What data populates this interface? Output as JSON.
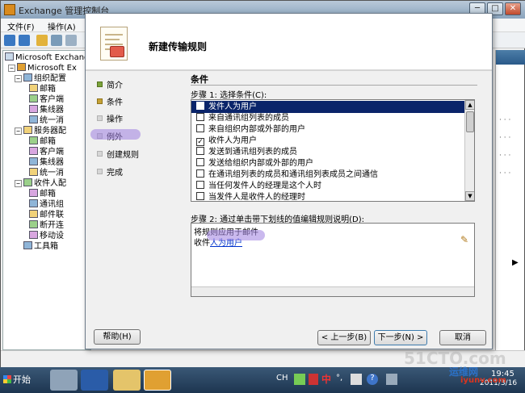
{
  "window": {
    "title": "Exchange 管理控制台",
    "controls": {
      "minimize": "─",
      "maximize": "□",
      "close": "✕"
    }
  },
  "menubar": {
    "items": [
      "文件(F)",
      "操作(A)"
    ]
  },
  "tree": {
    "root": "Microsoft Exchange",
    "level1": "Microsoft Ex",
    "nodes": [
      {
        "label": "组织配置",
        "level": 2,
        "expander": "−"
      },
      {
        "label": "邮箱",
        "level": 3
      },
      {
        "label": "客户端",
        "level": 3
      },
      {
        "label": "集线器",
        "level": 3
      },
      {
        "label": "统一消",
        "level": 3
      },
      {
        "label": "服务器配",
        "level": 2,
        "expander": "−"
      },
      {
        "label": "邮箱",
        "level": 3
      },
      {
        "label": "客户端",
        "level": 3
      },
      {
        "label": "集线器",
        "level": 3
      },
      {
        "label": "统一消",
        "level": 3
      },
      {
        "label": "收件人配",
        "level": 2,
        "expander": "−"
      },
      {
        "label": "邮箱",
        "level": 3
      },
      {
        "label": "通讯组",
        "level": 3
      },
      {
        "label": "邮件联",
        "level": 3
      },
      {
        "label": "断开连",
        "level": 3
      },
      {
        "label": "移动设",
        "level": 3
      },
      {
        "label": "工具箱",
        "level": 2
      }
    ]
  },
  "wizard": {
    "title": "新建传输规则",
    "steps": [
      {
        "label": "简介",
        "state": "done"
      },
      {
        "label": "条件",
        "state": "current"
      },
      {
        "label": "操作",
        "state": "pending"
      },
      {
        "label": "例外",
        "state": "pending"
      },
      {
        "label": "创建规则",
        "state": "pending"
      },
      {
        "label": "完成",
        "state": "pending"
      }
    ],
    "section_title": "条件",
    "step1_label": "步骤 1: 选择条件(C):",
    "conditions": [
      {
        "label": "发件人为用户",
        "checked": false,
        "selected": true
      },
      {
        "label": "来自通讯组列表的成员",
        "checked": false,
        "selected": false
      },
      {
        "label": "来自组织内部或外部的用户",
        "checked": false,
        "selected": false
      },
      {
        "label": "收件人为用户",
        "checked": true,
        "selected": false
      },
      {
        "label": "发送到通讯组列表的成员",
        "checked": false,
        "selected": false
      },
      {
        "label": "发送给组织内部或外部的用户",
        "checked": false,
        "selected": false
      },
      {
        "label": "在通讯组列表的成员和通讯组列表成员之间通信",
        "checked": false,
        "selected": false
      },
      {
        "label": "当任何发件人的经理是这个人时",
        "checked": false,
        "selected": false
      },
      {
        "label": "当发件人是收件人的经理时",
        "checked": false,
        "selected": false
      }
    ],
    "step2_label": "步骤 2: 通过单击带下划线的值编辑规则说明(D):",
    "description": {
      "line1": "将规则应用于邮件",
      "line2_prefix": "收件",
      "line2_link": "人为用户"
    },
    "buttons": {
      "help": "帮助(H)",
      "back": "< 上一步(B)",
      "next": "下一步(N) >",
      "cancel": "取消"
    }
  },
  "taskbar": {
    "start_label": "开始",
    "tray": {
      "lang": "CH",
      "ime": "中",
      "punct": "°,",
      "help": "?"
    },
    "clock_time": "19:45",
    "clock_date": "2011/3/16"
  },
  "watermark": {
    "main": "51CTO.com",
    "brand": "运维网",
    "url": "iyunv.com"
  },
  "colors": {
    "selection": "#0a246a",
    "highlight_marker": "#9e80e0",
    "link": "#0033cc"
  }
}
